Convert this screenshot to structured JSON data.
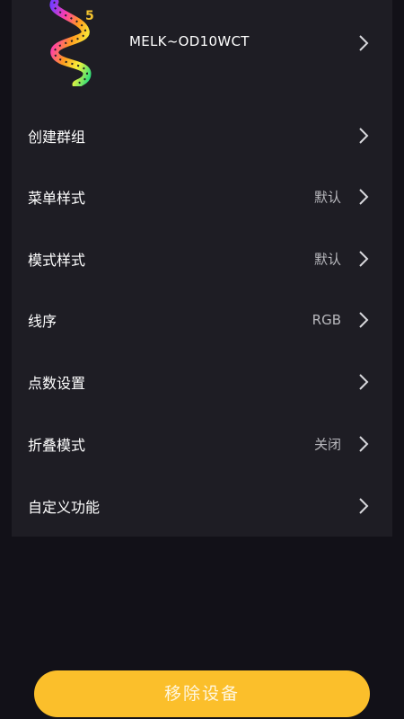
{
  "device": {
    "name": "MELK~OD10WCT",
    "logo_badge": "5"
  },
  "menu": [
    {
      "label": "创建群组",
      "value": ""
    },
    {
      "label": "菜单样式",
      "value": "默认"
    },
    {
      "label": "模式样式",
      "value": "默认"
    },
    {
      "label": "线序",
      "value": "RGB"
    },
    {
      "label": "点数设置",
      "value": ""
    },
    {
      "label": "折叠模式",
      "value": "关闭"
    },
    {
      "label": "自定义功能",
      "value": ""
    }
  ],
  "remove_button": {
    "label": "移除设备"
  },
  "colors": {
    "background": "#121118",
    "card": "#1e1d24",
    "accent": "#fbbf2b",
    "value_text": "#b9b9be"
  }
}
